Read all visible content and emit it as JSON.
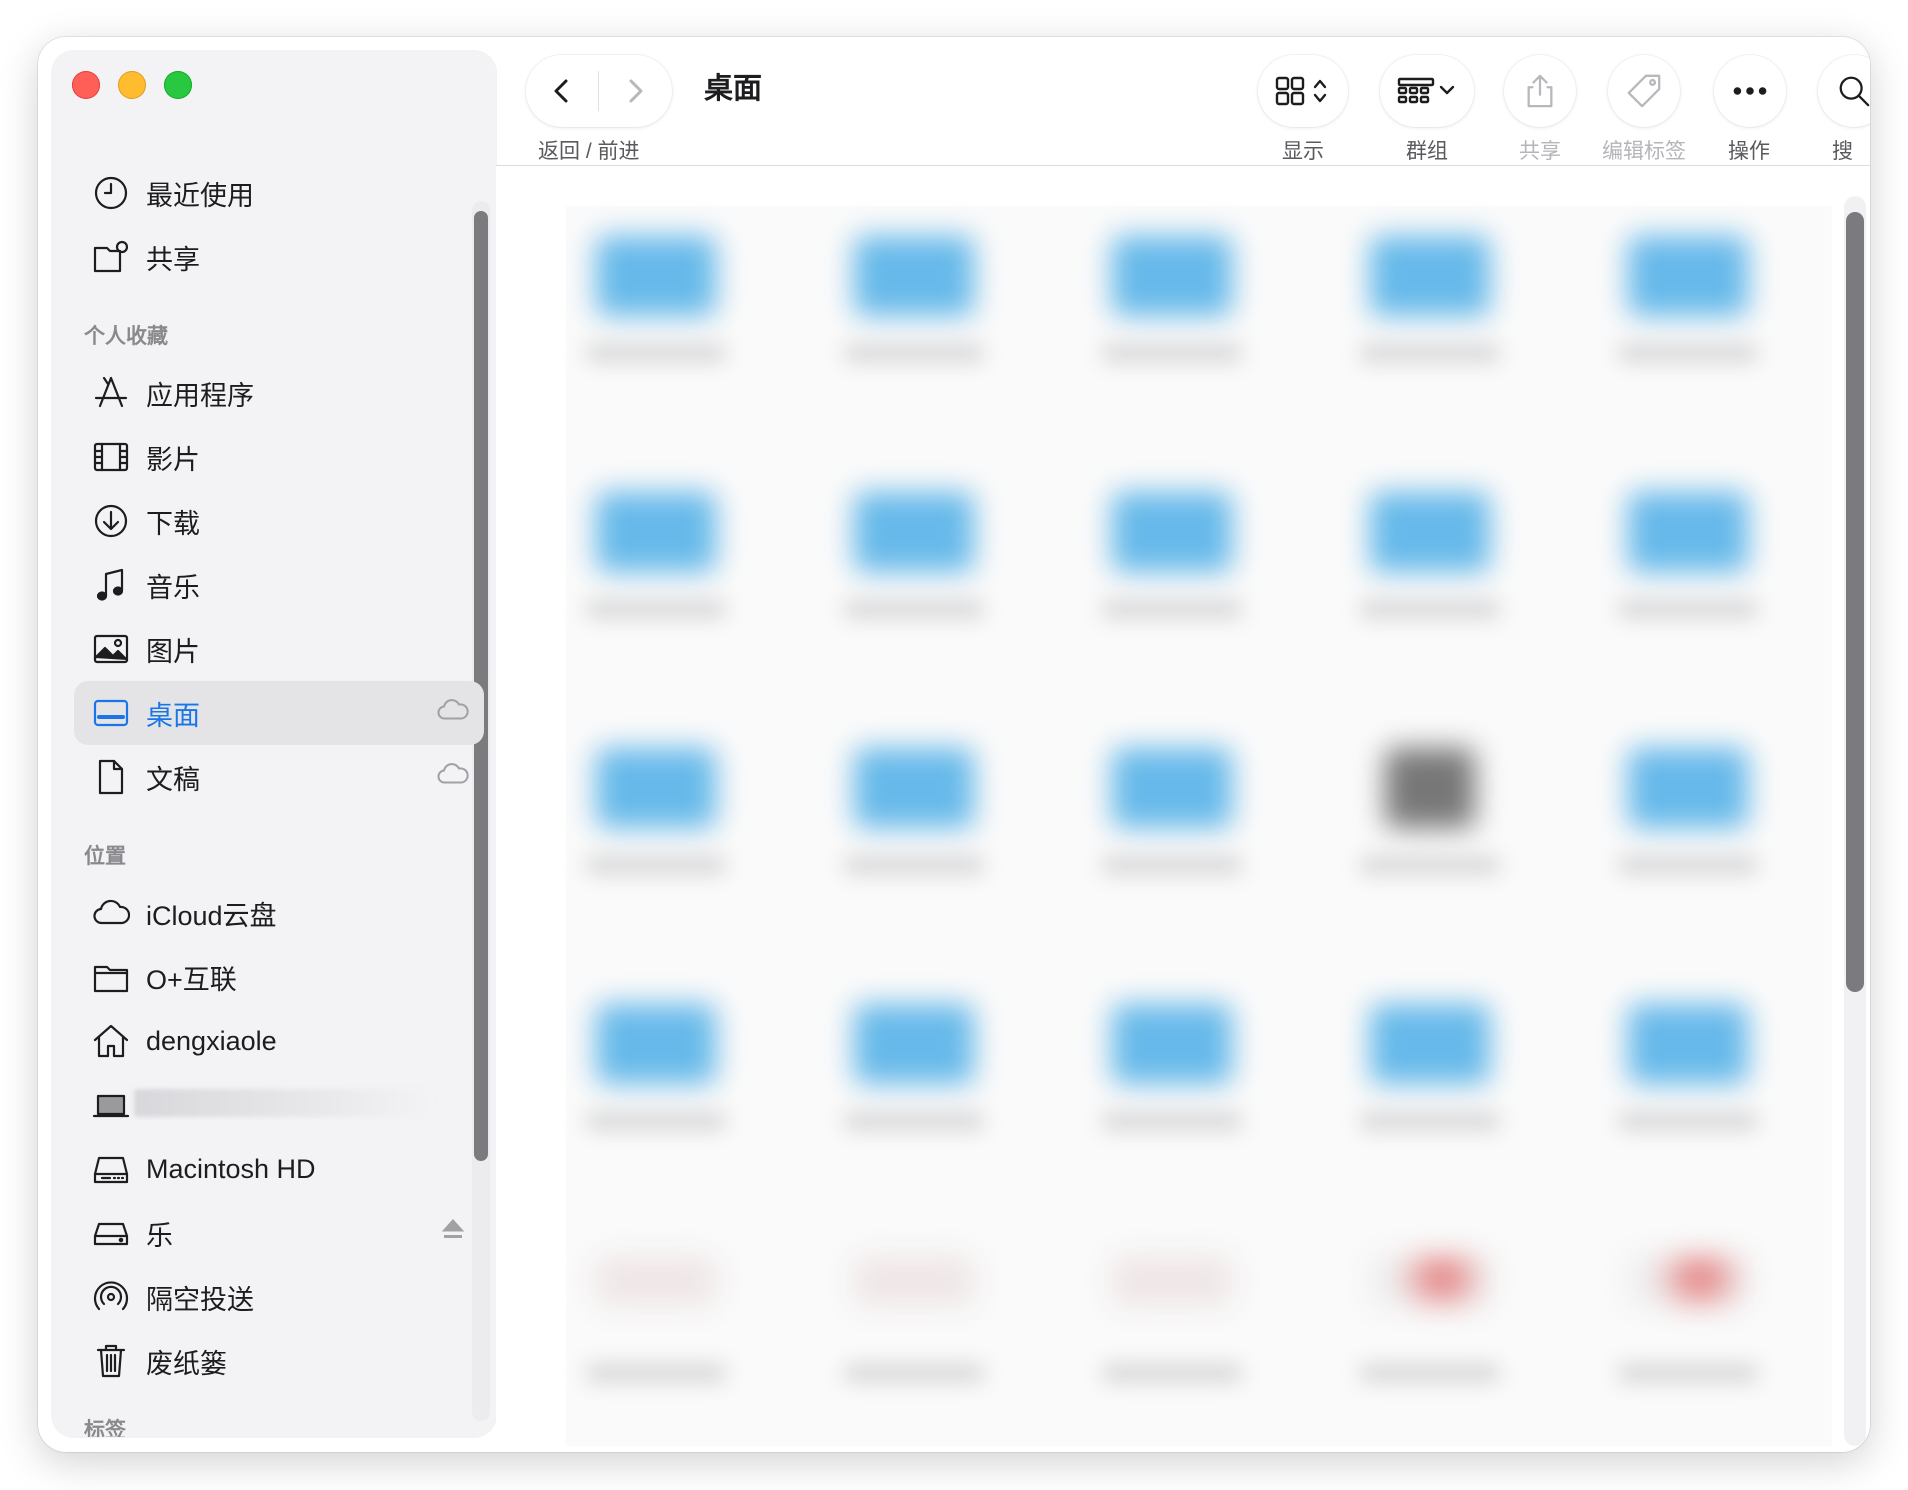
{
  "toolbar": {
    "back_forward_label": "返回 / 前进",
    "title": "桌面",
    "view_label": "显示",
    "group_label": "群组",
    "share_label": "共享",
    "tags_label": "编辑标签",
    "action_label": "操作",
    "search_label": "搜索"
  },
  "sidebar": {
    "recent": "最近使用",
    "shared": "共享",
    "favorites_header": "个人收藏",
    "favorites": [
      "应用程序",
      "影片",
      "下载",
      "音乐",
      "图片",
      "桌面",
      "文稿"
    ],
    "locations_header": "位置",
    "locations": [
      "iCloud云盘",
      "O+互联",
      "dengxiaole",
      "",
      "Macintosh HD",
      "乐",
      "隔空投送",
      "废纸篓"
    ],
    "tags_header": "标签",
    "active_item": "桌面"
  },
  "colors": {
    "accent": "#1a76e8",
    "folder": "#66b9ea",
    "traffic_red": "#ff5f57",
    "traffic_yellow": "#febc2e",
    "traffic_green": "#28c840"
  }
}
